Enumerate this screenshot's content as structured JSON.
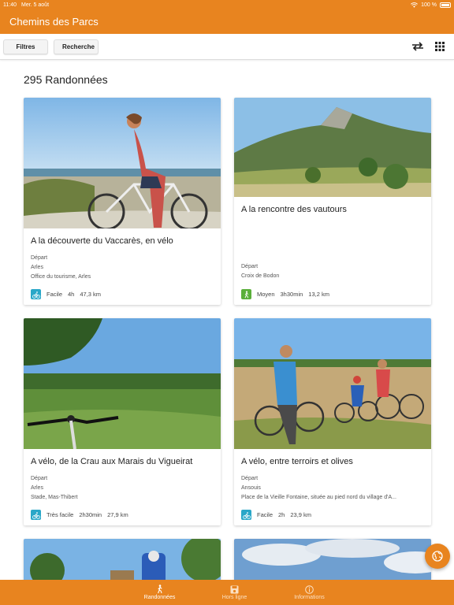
{
  "status": {
    "time": "11:40",
    "date": "Mer. 5 août",
    "battery": "100 %"
  },
  "app": {
    "title": "Chemins des Parcs"
  },
  "toolbar": {
    "filter_label": "Filtres",
    "search_label": "Recherche"
  },
  "list": {
    "count_label": "295 Randonnées"
  },
  "cards": [
    {
      "title": "A la découverte du Vaccarès, en vélo",
      "depart_label": "Départ",
      "city": "Arles",
      "place": "Office du tourisme, Arles",
      "difficulty": "Facile",
      "duration": "4h",
      "distance": "47,3 km",
      "activity": "bike-icon",
      "activity_color": "#2aa7c8"
    },
    {
      "title": "A la rencontre des vautours",
      "depart_label": "Départ",
      "city": "Croix de Bodon",
      "place": "",
      "difficulty": "Moyen",
      "duration": "3h30min",
      "distance": "13,2 km",
      "activity": "hiker-icon",
      "activity_color": "#5aaf3a"
    },
    {
      "title": "A vélo, de la Crau aux Marais du Vigueirat",
      "depart_label": "Départ",
      "city": "Arles",
      "place": "Stade, Mas-Thibert",
      "difficulty": "Très facile",
      "duration": "2h30min",
      "distance": "27,9 km",
      "activity": "bike-icon",
      "activity_color": "#2aa7c8"
    },
    {
      "title": "A vélo, entre terroirs et olives",
      "depart_label": "Départ",
      "city": "Ansouis",
      "place": "Place de la Vieille Fontaine, située au pied nord du village d'A...",
      "difficulty": "Facile",
      "duration": "2h",
      "distance": "23,9 km",
      "activity": "bike-icon",
      "activity_color": "#2aa7c8"
    }
  ],
  "nav": [
    {
      "label": "Randonnées",
      "icon": "hiker-icon",
      "active": true
    },
    {
      "label": "Hors ligne",
      "icon": "save-icon",
      "active": false
    },
    {
      "label": "Informations",
      "icon": "info-icon",
      "active": false
    }
  ],
  "colors": {
    "accent": "#e8841f",
    "bike": "#2aa7c8",
    "hike": "#5aaf3a"
  }
}
